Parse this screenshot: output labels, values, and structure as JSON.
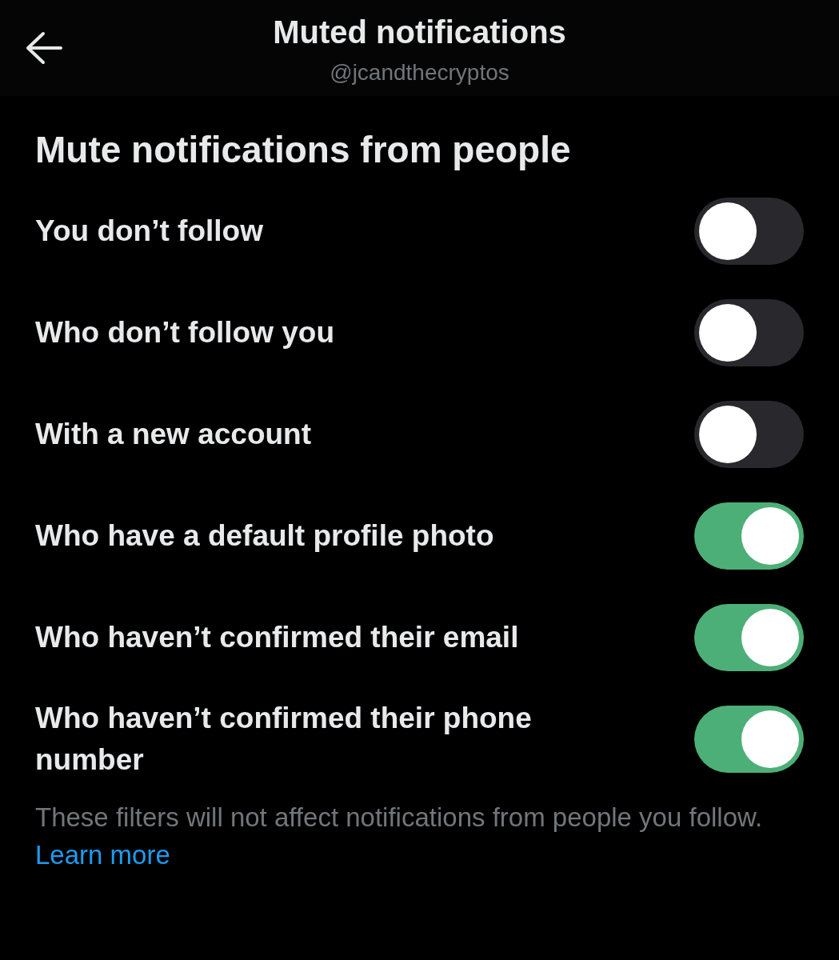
{
  "header": {
    "title": "Muted notifications",
    "subtitle": "@jcandthecryptos"
  },
  "section": {
    "title": "Mute notifications from people"
  },
  "options": [
    {
      "label": "You don’t follow",
      "checked": false
    },
    {
      "label": "Who don’t follow you",
      "checked": false
    },
    {
      "label": "With a new account",
      "checked": false
    },
    {
      "label": "Who have a default profile photo",
      "checked": true
    },
    {
      "label": "Who haven’t confirmed their email",
      "checked": true
    },
    {
      "label": "Who haven’t confirmed their phone number",
      "checked": true
    }
  ],
  "footer": {
    "text": "These filters will not affect notifications from people you follow.",
    "link": "Learn more"
  }
}
